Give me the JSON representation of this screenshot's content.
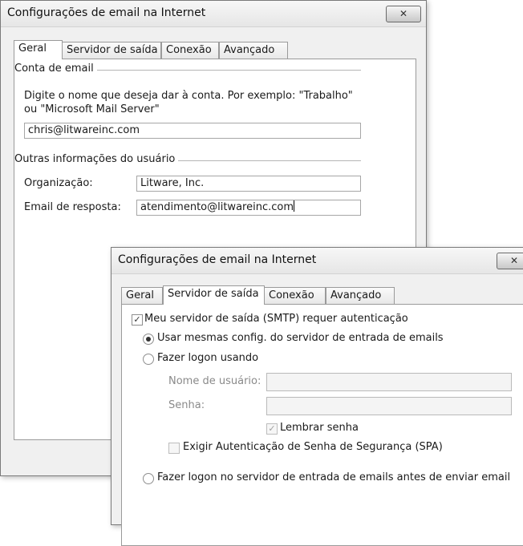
{
  "back_dialog": {
    "title": "Configurações de email na Internet",
    "close_glyph": "✕",
    "tabs": [
      {
        "label": "Geral",
        "active": true
      },
      {
        "label": "Servidor de saída",
        "active": false
      },
      {
        "label": "Conexão",
        "active": false
      },
      {
        "label": "Avançado",
        "active": false
      }
    ],
    "account_group": "Conta de email",
    "account_hint_line1": "Digite o nome que deseja dar à conta. Por exemplo: \"Trabalho\"",
    "account_hint_line2": "ou \"Microsoft Mail Server\"",
    "account_name_value": "chris@litwareinc.com",
    "user_group": "Outras informações do usuário",
    "organization_label": "Organização:",
    "organization_value": "Litware, Inc.",
    "reply_label": "Email de resposta:",
    "reply_value": "atendimento@litwareinc.com"
  },
  "front_dialog": {
    "title": "Configurações de email na Internet",
    "close_glyph": "✕",
    "tabs": [
      {
        "label": "Geral",
        "active": false
      },
      {
        "label": "Servidor de saída",
        "active": true
      },
      {
        "label": "Conexão",
        "active": false
      },
      {
        "label": "Avançado",
        "active": false
      }
    ],
    "smtp_auth_label": "Meu servidor de saída (SMTP) requer autenticação",
    "smtp_auth_checked": true,
    "use_same_label": "Usar mesmas config. do servidor de entrada de emails",
    "logon_using_label": "Fazer logon usando",
    "username_label": "Nome de usuário:",
    "username_value": "",
    "password_label": "Senha:",
    "password_value": "",
    "remember_label": "Lembrar senha",
    "remember_checked": true,
    "spa_label": "Exigir Autenticação de Senha de Segurança (SPA)",
    "logon_incoming_label": "Fazer logon no servidor de entrada de emails antes de enviar email"
  },
  "icons": {
    "check_glyph": "✓"
  }
}
